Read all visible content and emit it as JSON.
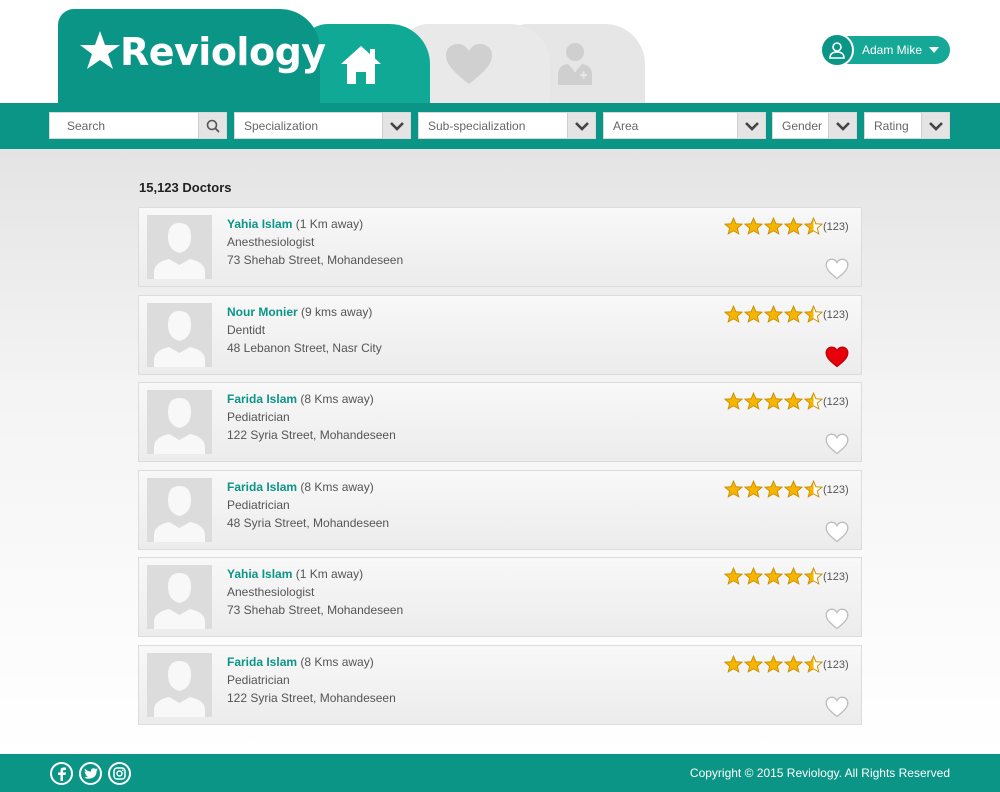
{
  "brand": {
    "name": "Reviology",
    "accent": "#0b9587",
    "accent_light": "#16a896"
  },
  "nav": {
    "tabs": [
      {
        "id": "home",
        "icon": "home-icon",
        "active": true
      },
      {
        "id": "favorites",
        "icon": "heart-icon",
        "active": false
      },
      {
        "id": "doctors",
        "icon": "doctor-icon",
        "active": false
      }
    ]
  },
  "user": {
    "name": "Adam Mike",
    "icon": "user-icon"
  },
  "filters": {
    "search": {
      "placeholder": "Search",
      "icon": "search-icon"
    },
    "specialization": "Specialization",
    "sub_specialization": "Sub-specialization",
    "area": "Area",
    "gender": "Gender",
    "rating": "Rating"
  },
  "results": {
    "count_label": "15,123 Doctors",
    "doctors": [
      {
        "name": "Yahia Islam",
        "distance": "(1 Km away)",
        "specialty": "Anesthesiologist",
        "address": "73 Shehab Street, Mohandeseen",
        "rating": 4.5,
        "reviews": "(123)",
        "favorite": false
      },
      {
        "name": "Nour Monier",
        "distance": "(9 kms away)",
        "specialty": "Dentidt",
        "address": "48 Lebanon Street, Nasr City",
        "rating": 4.5,
        "reviews": "(123)",
        "favorite": true
      },
      {
        "name": "Farida Islam",
        "distance": "(8 Kms away)",
        "specialty": "Pediatrician",
        "address": "122 Syria Street, Mohandeseen",
        "rating": 4.5,
        "reviews": "(123)",
        "favorite": false
      },
      {
        "name": "Farida Islam",
        "distance": "(8 Kms away)",
        "specialty": "Pediatrician",
        "address": "48 Syria Street, Mohandeseen",
        "rating": 4.5,
        "reviews": "(123)",
        "favorite": false
      },
      {
        "name": "Yahia Islam",
        "distance": "(1 Km away)",
        "specialty": "Anesthesiologist",
        "address": "73 Shehab Street, Mohandeseen",
        "rating": 4.5,
        "reviews": "(123)",
        "favorite": false
      },
      {
        "name": "Farida Islam",
        "distance": "(8 Kms away)",
        "specialty": "Pediatrician",
        "address": "122 Syria Street, Mohandeseen",
        "rating": 4.5,
        "reviews": "(123)",
        "favorite": false
      }
    ]
  },
  "footer": {
    "social": [
      "facebook-icon",
      "twitter-icon",
      "instagram-icon"
    ],
    "copyright": "Copyright © 2015 Reviology. All Rights Reserved"
  }
}
